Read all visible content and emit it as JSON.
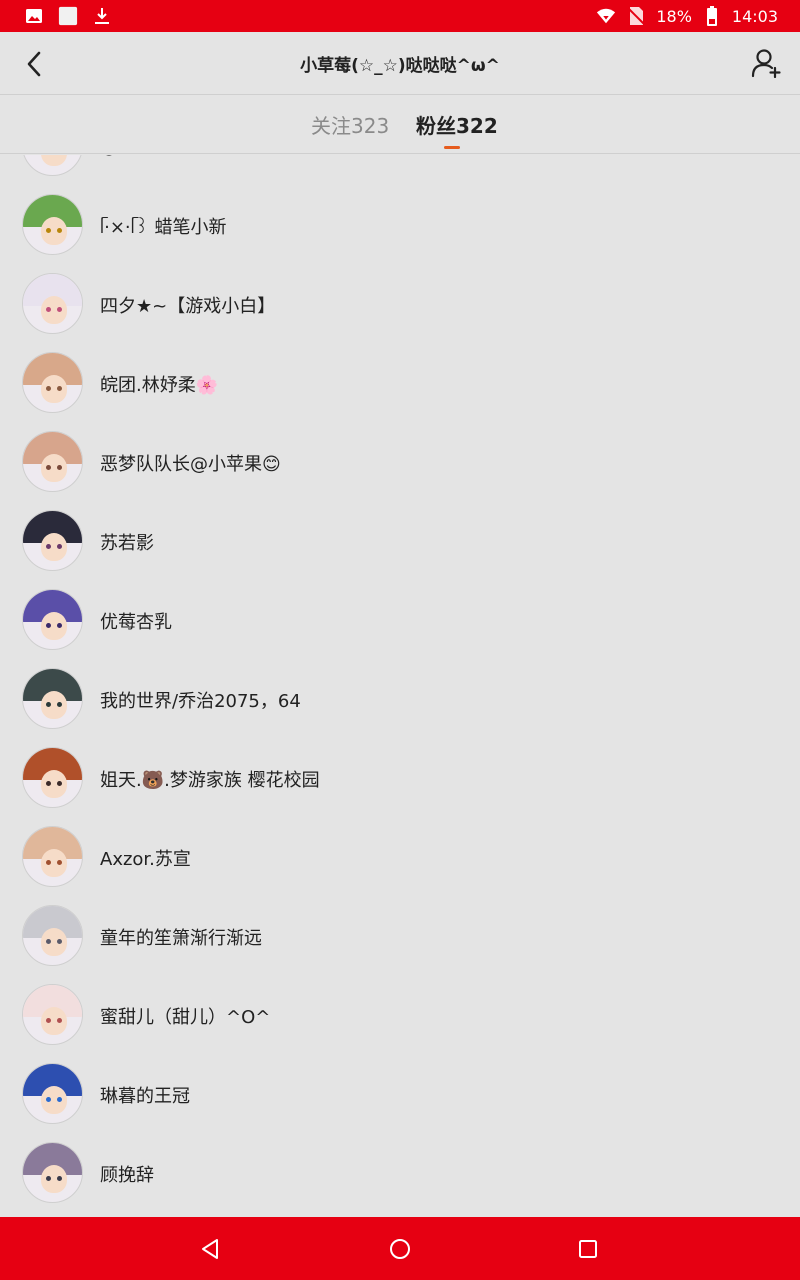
{
  "status_bar": {
    "icons_left": [
      "image-icon",
      "square-icon",
      "download-icon"
    ],
    "battery": "18%",
    "time": "14:03"
  },
  "header": {
    "title": "小草莓(☆_☆)哒哒哒^ω^"
  },
  "tabs": {
    "following_label": "关注323",
    "fans_label": "粉丝322",
    "active": "fans"
  },
  "fans": [
    {
      "name": "㋡宝",
      "hair": "#d9a07a",
      "eye": "#7a5a3a"
    },
    {
      "name": "ᥬ·×·ᥬ꒱ 蜡笔小新",
      "hair": "#6aa84f",
      "eye": "#b8860b"
    },
    {
      "name": "四夕★~【游戏小白】",
      "hair": "#e8e2ee",
      "eye": "#c0507a"
    },
    {
      "name": "皖团.林妤柔🌸",
      "hair": "#d8a88a",
      "eye": "#8a5a40"
    },
    {
      "name": "恶梦队队长@小苹果😊",
      "hair": "#d7a58c",
      "eye": "#7a4a3a"
    },
    {
      "name": "苏若影",
      "hair": "#2a2a3a",
      "eye": "#6a3a6a"
    },
    {
      "name": "优莓杏乳",
      "hair": "#5a4fa8",
      "eye": "#3a2a6a"
    },
    {
      "name": "我的世界/乔治2075，64",
      "hair": "#3c4a4a",
      "eye": "#2a3a3a"
    },
    {
      "name": "姐天.🐻.梦游家族 樱花校园",
      "hair": "#b0502a",
      "eye": "#3a2a2a"
    },
    {
      "name": "Axzor.苏宣",
      "hair": "#e0b79a",
      "eye": "#a05030"
    },
    {
      "name": "童年的笙箫渐行渐远",
      "hair": "#c9c9cf",
      "eye": "#5a5a6a"
    },
    {
      "name": "蜜甜儿（甜儿）^O^",
      "hair": "#f2dede",
      "eye": "#b05050"
    },
    {
      "name": "琳暮的王冠",
      "hair": "#2d4fb0",
      "eye": "#2a6ad0"
    },
    {
      "name": "顾挽辞",
      "hair": "#8a7a9a",
      "eye": "#3a3a4a"
    }
  ],
  "nav": {
    "back": "back-triangle-icon",
    "home": "home-circle-icon",
    "recents": "recents-square-icon"
  }
}
